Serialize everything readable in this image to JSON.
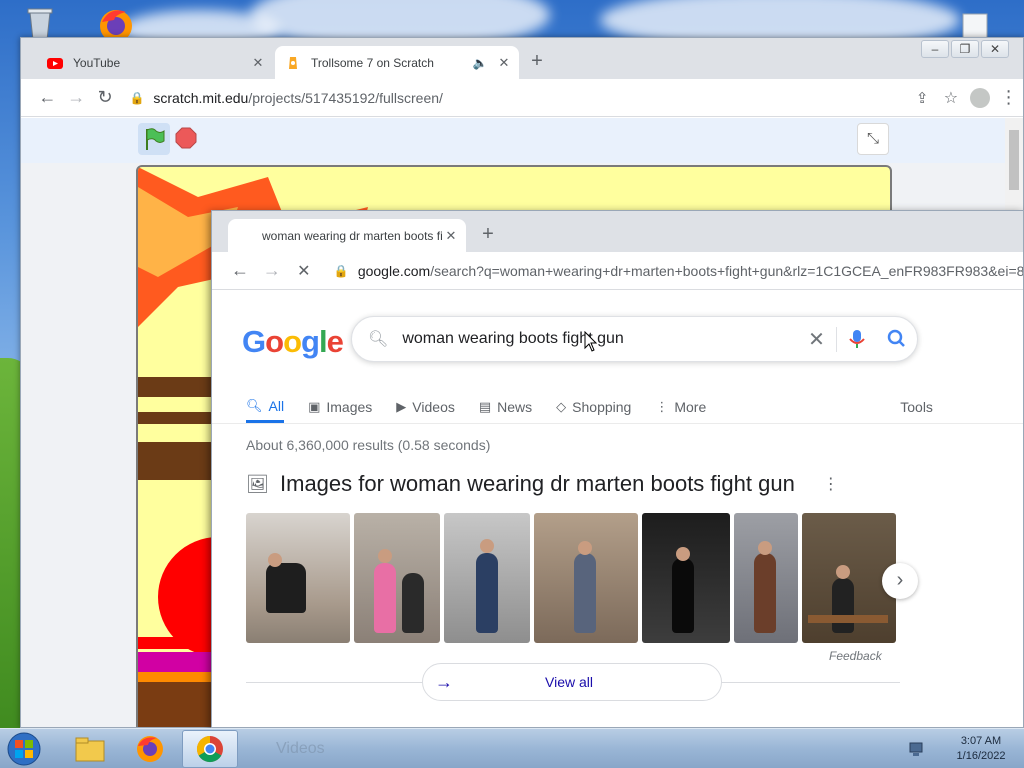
{
  "desktop": {
    "taskbar": {
      "time": "3:07 AM",
      "date": "1/16/2022",
      "ghost_text": "Videos"
    }
  },
  "window_back": {
    "tabs": [
      {
        "title": "YouTube",
        "active": false
      },
      {
        "title": "Trollsome 7 on Scratch",
        "active": true
      }
    ],
    "url_host": "scratch.mit.edu",
    "url_path": "/projects/517435192/fullscreen/"
  },
  "window_front": {
    "tab_title": "woman wearing dr marten boots fight gun",
    "url_host": "google.com",
    "url_path": "/search?q=woman+wearing+dr+marten+boots+fight+gun&rlz=1C1GCEA_enFR983FR983&ei=8",
    "google": {
      "logo": "Google",
      "query": "woman wearing boots fight gun",
      "tabs": [
        "All",
        "Images",
        "Videos",
        "News",
        "Shopping",
        "More"
      ],
      "tools": "Tools",
      "stats": "About 6,360,000 results (0.58 seconds)",
      "images_heading": "Images for woman wearing dr marten boots fight gun",
      "feedback": "Feedback",
      "view_all": "View all"
    }
  },
  "colors": {
    "google_blue": "#4285f4",
    "google_red": "#ea4335",
    "google_yellow": "#fbbc05",
    "google_green": "#34a853",
    "link": "#1a73e8"
  }
}
